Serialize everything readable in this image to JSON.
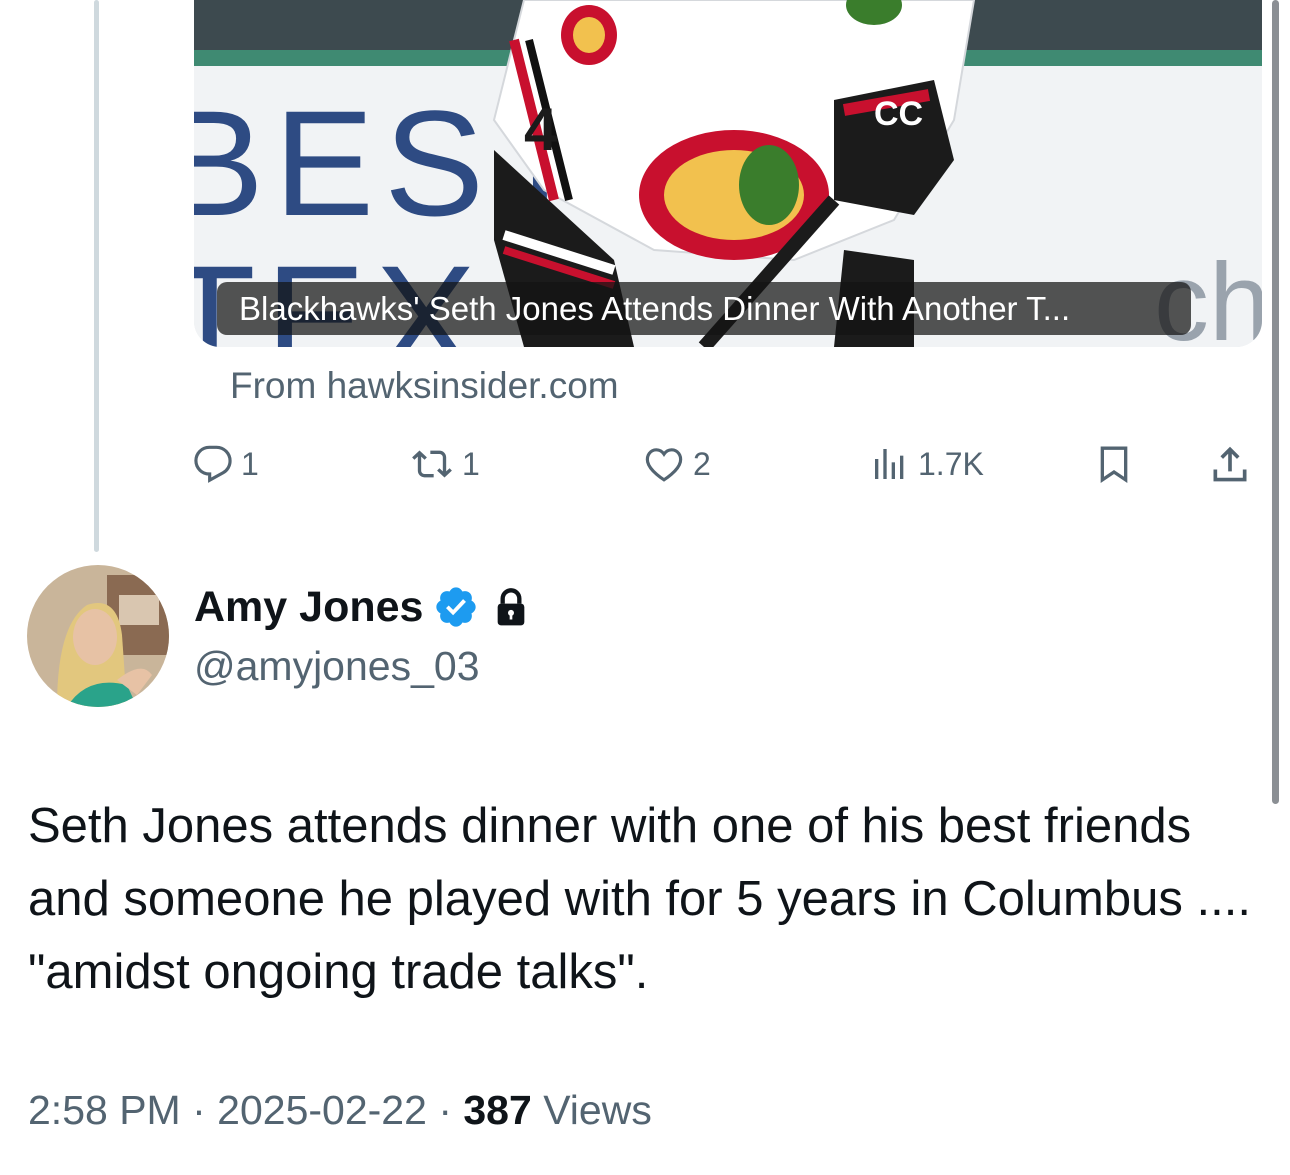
{
  "card": {
    "caption": "Blackhawks' Seth Jones Attends Dinner With Another T...",
    "source": "From hawksinsider.com",
    "image_icon": "hockey-player-photo"
  },
  "actions": {
    "replies": "1",
    "retweets": "1",
    "likes": "2",
    "views": "1.7K"
  },
  "author": {
    "name": "Amy Jones",
    "handle": "@amyjones_03",
    "verified": true,
    "protected": true
  },
  "tweet": {
    "text": "Seth Jones attends dinner with one of his best friends and someone he played with for 5 years in Columbus .... \"amidst ongoing trade talks\"."
  },
  "meta": {
    "time": "2:58 PM",
    "separator": "·",
    "date": "2025-02-22",
    "views_count": "387",
    "views_label": "Views"
  },
  "colors": {
    "text": "#0f1419",
    "secondary": "#536471",
    "verified": "#1d9bf0",
    "thread_line": "#cfd9de"
  }
}
